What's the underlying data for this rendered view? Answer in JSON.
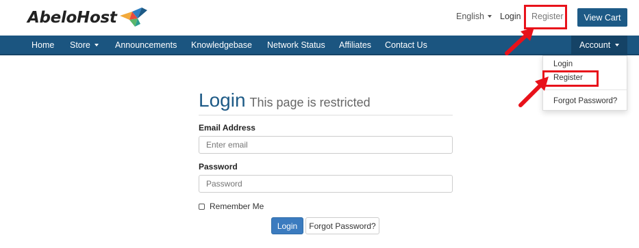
{
  "header": {
    "logo_text": "AbeloHost",
    "language": "English",
    "login": "Login",
    "register": "Register",
    "view_cart": "View Cart"
  },
  "nav": {
    "items": [
      "Home",
      "Store",
      "Announcements",
      "Knowledgebase",
      "Network Status",
      "Affiliates",
      "Contact Us"
    ],
    "account": "Account"
  },
  "account_menu": {
    "login": "Login",
    "register": "Register",
    "forgot": "Forgot Password?"
  },
  "form": {
    "title": "Login",
    "subtitle": "This page is restricted",
    "email_label": "Email Address",
    "email_placeholder": "Enter email",
    "password_label": "Password",
    "password_placeholder": "Password",
    "remember": "Remember Me",
    "login_button": "Login",
    "forgot_button": "Forgot Password?"
  },
  "colors": {
    "brand_blue": "#1b5580",
    "button_blue": "#3b7bbf",
    "annotation_red": "#e8111a"
  },
  "icons": [
    "logo-bird-icon",
    "caret-down-icon",
    "annotation-arrow-icon",
    "checkbox-icon"
  ]
}
